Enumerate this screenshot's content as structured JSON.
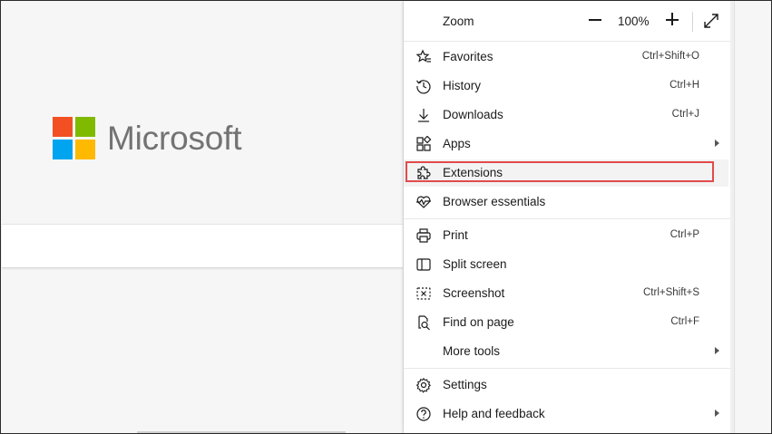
{
  "brand": {
    "name": "Microsoft",
    "colors": [
      "#f25022",
      "#7fba00",
      "#00a4ef",
      "#ffb900"
    ]
  },
  "menu": {
    "zoom": {
      "label": "Zoom",
      "value": "100%"
    },
    "items": [
      {
        "label": "Favorites",
        "shortcut": "Ctrl+Shift+O",
        "icon": "star-list-icon"
      },
      {
        "label": "History",
        "shortcut": "Ctrl+H",
        "icon": "history-icon"
      },
      {
        "label": "Downloads",
        "shortcut": "Ctrl+J",
        "icon": "download-icon"
      },
      {
        "label": "Apps",
        "shortcut": "",
        "icon": "apps-icon",
        "submenu": true
      },
      {
        "label": "Extensions",
        "shortcut": "",
        "icon": "puzzle-icon",
        "highlighted": true
      },
      {
        "label": "Browser essentials",
        "shortcut": "",
        "icon": "heartbeat-icon"
      },
      {
        "label": "Print",
        "shortcut": "Ctrl+P",
        "icon": "printer-icon"
      },
      {
        "label": "Split screen",
        "shortcut": "",
        "icon": "split-screen-icon"
      },
      {
        "label": "Screenshot",
        "shortcut": "Ctrl+Shift+S",
        "icon": "screenshot-icon"
      },
      {
        "label": "Find on page",
        "shortcut": "Ctrl+F",
        "icon": "find-icon"
      },
      {
        "label": "More tools",
        "shortcut": "",
        "icon": "",
        "submenu": true
      },
      {
        "label": "Settings",
        "shortcut": "",
        "icon": "gear-icon"
      },
      {
        "label": "Help and feedback",
        "shortcut": "",
        "icon": "help-icon",
        "submenu": true
      }
    ]
  },
  "highlight_color": "#e14b4b"
}
